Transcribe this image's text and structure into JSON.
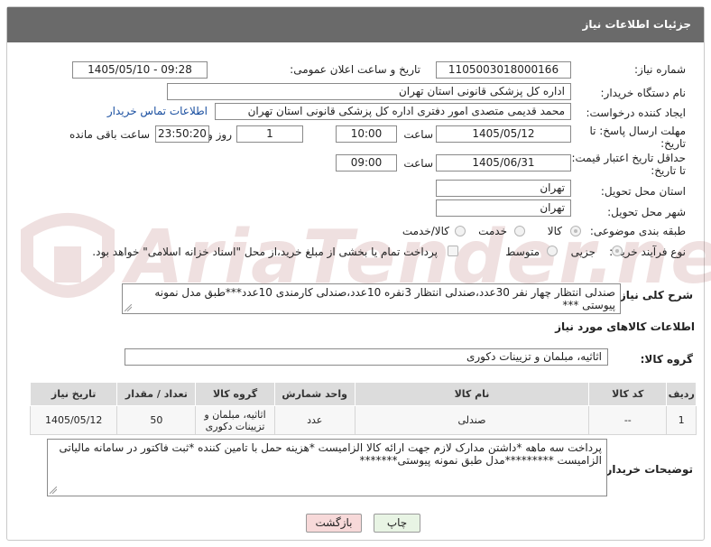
{
  "header": {
    "title": "جزئیات اطلاعات نیاز"
  },
  "form": {
    "need_number_label": "شماره نیاز:",
    "need_number": "1105003018000166",
    "announce_label": "تاریخ و ساعت اعلان عمومی:",
    "announce_value": "1405/05/10 - 09:28",
    "buyer_org_label": "نام دستگاه خریدار:",
    "buyer_org": "اداره کل پزشکی قانونی استان تهران",
    "creator_label": "ایجاد کننده درخواست:",
    "creator": "محمد قدیمی متصدی امور دفتری اداره کل پزشکی قانونی استان تهران",
    "contact_link": "اطلاعات تماس خریدار",
    "deadline_label_1": "مهلت ارسال پاسخ: تا",
    "deadline_label_2": "تاریخ:",
    "deadline_date": "1405/05/12",
    "time_label": "ساعت",
    "deadline_time": "10:00",
    "days_value": "1",
    "days_label": "روز و",
    "remaining_time": "23:50:20",
    "remaining_label": "ساعت باقی مانده",
    "validity_label_1": "حداقل تاریخ اعتبار قیمت:",
    "validity_label_2": "تا تاریخ:",
    "validity_date": "1405/06/31",
    "validity_time_label": "ساعت",
    "validity_time": "09:00",
    "province_label": "استان محل تحویل:",
    "province": "تهران",
    "city_label": "شهر محل تحویل:",
    "city": "تهران",
    "category_label": "طبقه بندی موضوعی:",
    "category_options": [
      "کالا",
      "خدمت",
      "کالا/خدمت"
    ],
    "process_label": "نوع فرآیند خرید :",
    "process_options": [
      "جزیی",
      "متوسط"
    ],
    "payment_note": "پرداخت تمام یا بخشی از مبلغ خرید،از محل \"اسناد خزانه اسلامی\" خواهد بود."
  },
  "description": {
    "label": "شرح کلی نیاز:",
    "text": "صندلی انتظار چهار نفر 30عدد،صندلی انتظار 3نفره 10عدد،صندلی کارمندی 10عدد***طبق مدل نمونه پیوستی ***"
  },
  "items_section": {
    "title": "اطلاعات کالاهای مورد نیاز",
    "group_label": "گروه کالا:",
    "group_value": "اثاثیه، مبلمان و تزیینات دکوری"
  },
  "table": {
    "headers": [
      "ردیف",
      "کد کالا",
      "نام کالا",
      "واحد شمارش",
      "گروه کالا",
      "تعداد / مقدار",
      "تاریخ نیاز"
    ],
    "rows": [
      {
        "row": "1",
        "code": "--",
        "name": "صندلی",
        "unit": "عدد",
        "group": "اثاثیه، مبلمان و تزیینات دکوری",
        "qty": "50",
        "date": "1405/05/12"
      }
    ]
  },
  "buyer_notes": {
    "label": "توضیحات خریدار:",
    "text": "پرداخت سه ماهه *داشتن مدارک لازم جهت ارائه کالا الزامیست *هزینه حمل با تامین کننده *ثبت فاکتور در سامانه مالیاتی الزامیست *********مدل طبق نمونه پیوستی*******"
  },
  "buttons": {
    "print": "چاپ",
    "back": "بازگشت"
  },
  "watermark": {
    "text": "AriaTender.neT"
  },
  "colors": {
    "header_bg": "#6a6a6a",
    "link": "#1a4fa0",
    "back_btn_bg": "#f7d9d9",
    "print_btn_bg": "#e8f4e4"
  }
}
